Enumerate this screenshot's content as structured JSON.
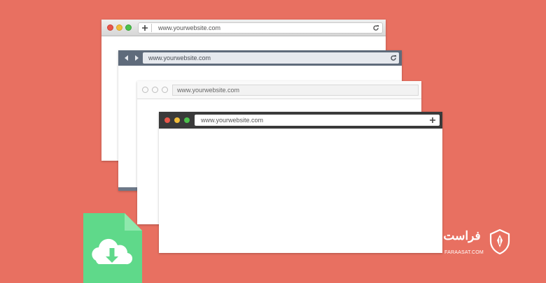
{
  "windows": [
    {
      "style": "classic",
      "url": "www.yourwebsite.com",
      "dots": [
        "#e9574a",
        "#f1bd3a",
        "#4cc14c"
      ]
    },
    {
      "style": "dark-blue",
      "url": "www.yourwebsite.com"
    },
    {
      "style": "flat-light",
      "url": "www.yourwebsite.com"
    },
    {
      "style": "dark",
      "url": "www.yourwebsite.com",
      "dots": [
        "#e9574a",
        "#f1bd3a",
        "#4cc14c"
      ]
    }
  ],
  "file_icon": {
    "color": "#5fd98a",
    "icons": [
      "cloud-icon",
      "download-arrow-icon"
    ]
  },
  "logo": {
    "text_fa": "فراست",
    "text_en": "FARAASAT.COM"
  },
  "colors": {
    "background": "#e87061",
    "window_bg": "#ffffff"
  }
}
